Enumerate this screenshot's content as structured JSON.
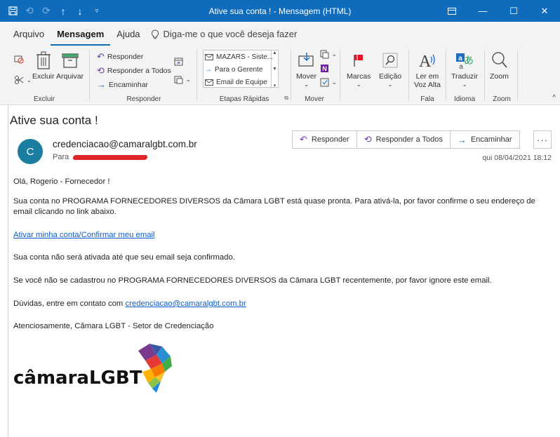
{
  "window": {
    "title": "Ative sua conta !  -  Mensagem (HTML)"
  },
  "menu": {
    "tabs": [
      "Arquivo",
      "Mensagem",
      "Ajuda"
    ],
    "tellme": "Diga-me o que você deseja fazer"
  },
  "ribbon": {
    "excluir_group": {
      "label": "Excluir",
      "delete": "Excluir",
      "archive": "Arquivar"
    },
    "responder_group": {
      "label": "Responder",
      "reply": "Responder",
      "reply_all": "Responder a Todos",
      "forward": "Encaminhar"
    },
    "quick_steps": {
      "label": "Etapas Rápidas",
      "items": [
        "MAZARS - Siste...",
        "Para o Gerente",
        "Email de Equipe"
      ]
    },
    "mover_group": {
      "label": "Mover",
      "move": "Mover"
    },
    "marcas": {
      "label": "Marcas"
    },
    "edicao": {
      "label": "Edição"
    },
    "fala": {
      "label": "Fala",
      "read_aloud_1": "Ler em",
      "read_aloud_2": "Voz Alta"
    },
    "idioma": {
      "label": "Idioma",
      "translate": "Traduzir"
    },
    "zoom": {
      "label": "Zoom",
      "zoom": "Zoom"
    }
  },
  "message": {
    "subject": "Ative sua conta !",
    "avatar_initial": "C",
    "sender": "credenciacao@camaralgbt.com.br",
    "to_label": "Para",
    "datetime": "qui 08/04/2021 18:12",
    "actions": {
      "reply": "Responder",
      "reply_all": "Responder a Todos",
      "forward": "Encaminhar",
      "more": "···"
    },
    "body": {
      "greeting": "Olá, Rogerio - Fornecedor !",
      "p1": "Sua conta no PROGRAMA FORNECEDORES DIVERSOS da Câmara LGBT está quase pronta. Para ativá-la, por favor confirme o seu endereço de email clicando no link abaixo.",
      "activate_link": "Ativar minha conta/Confirmar meu email",
      "p2": "Sua conta não será ativada até que seu email seja confirmado.",
      "p3": "Se você não se cadastrou no PROGRAMA FORNECEDORES DIVERSOS da Câmara LGBT recentemente, por favor ignore este email.",
      "p4_prefix": "Dúvidas, entre em contato com ",
      "p4_link": "credenciacao@camaralgbt.com.br",
      "signature": "Atenciosamente, Câmara LGBT - Setor de Credenciação",
      "logo_text": "câmaraLGBT"
    }
  },
  "colors": {
    "accent": "#0f6cbd",
    "link": "#0b5cc9",
    "avatar": "#1b7ea0"
  }
}
